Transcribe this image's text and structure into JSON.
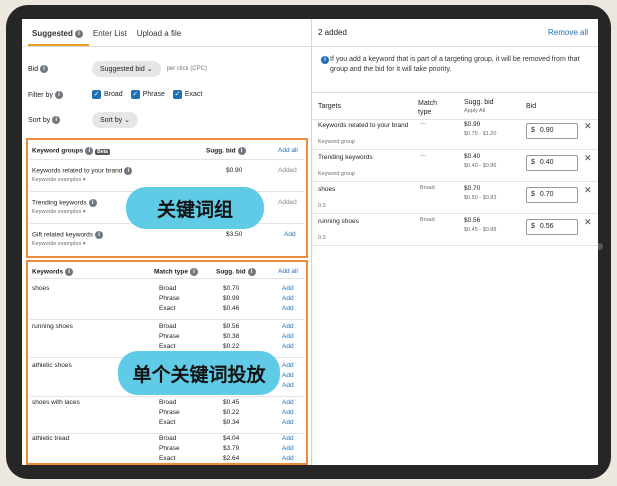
{
  "tabs": [
    "Suggested",
    "Enter List",
    "Upload a file"
  ],
  "bid": {
    "label": "Bid",
    "value": "Suggested bid",
    "note": "per click (CPC)"
  },
  "filter": {
    "label": "Filter by",
    "options": [
      "Broad",
      "Phrase",
      "Exact"
    ]
  },
  "sort": {
    "label": "Sort by",
    "value": "Sort by"
  },
  "groups": {
    "header": "Keyword groups",
    "badge": "Beta",
    "bid_header": "Sugg. bid",
    "add_all": "Add all",
    "items": [
      {
        "name": "Keywords related to your brand",
        "sub": "Keywords examples",
        "bid": "$0.90",
        "action": "Added"
      },
      {
        "name": "Trending keywords",
        "sub": "Keywords examples",
        "bid": "",
        "action": "Added"
      },
      {
        "name": "Gift related keywords",
        "sub": "Keywords examples",
        "bid": "$3.50",
        "action": "Add"
      }
    ]
  },
  "keywords": {
    "header": "Keywords",
    "match_header": "Match type",
    "bid_header": "Sugg. bid",
    "add_all": "Add all",
    "rows": [
      {
        "name": "shoes",
        "items": [
          [
            "Broad",
            "$0.70"
          ],
          [
            "Phrase",
            "$0.99"
          ],
          [
            "Exact",
            "$0.46"
          ]
        ]
      },
      {
        "name": "running shoes",
        "items": [
          [
            "Broad",
            "$0.56"
          ],
          [
            "Phrase",
            "$0.38"
          ],
          [
            "Exact",
            "$0.22"
          ]
        ]
      },
      {
        "name": "athletic shoes",
        "items": [
          [
            "",
            ""
          ],
          [
            "",
            ""
          ],
          [
            "",
            ""
          ]
        ]
      },
      {
        "name": "shoes with laces",
        "items": [
          [
            "Broad",
            "$0.45"
          ],
          [
            "Phrase",
            "$0.22"
          ],
          [
            "Exact",
            "$0.34"
          ]
        ]
      },
      {
        "name": "athletic tread",
        "items": [
          [
            "Broad",
            "$4.04"
          ],
          [
            "Phrase",
            "$3.79"
          ],
          [
            "Exact",
            "$2.64"
          ]
        ]
      }
    ],
    "add": "Add"
  },
  "overlays": {
    "groups_label": "关键词组",
    "single_label": "单个关键词投放"
  },
  "right": {
    "count": "2 added",
    "remove_all": "Remove all",
    "notice": "If you add a keyword that is part of a targeting group, it will be removed from that group and the bid for it will take priority.",
    "headers": {
      "targets": "Targets",
      "match": "Match type",
      "sugg": "Sugg. bid",
      "apply": "Apply All",
      "bid": "Bid"
    },
    "rows": [
      {
        "name": "Keywords related to your brand",
        "sub": "Keyword group",
        "match": "—",
        "sugg": "$0.90",
        "range": "$0.75 - $1.20",
        "bid": "0.90"
      },
      {
        "name": "Trending keywords",
        "sub": "Keyword group",
        "match": "—",
        "sugg": "$0.40",
        "range": "$0.40 - $0.86",
        "bid": "0.40"
      },
      {
        "name": "shoes",
        "sub": "0.0",
        "match": "Broad",
        "sugg": "$0.70",
        "range": "$0.50 - $0.83",
        "bid": "0.70"
      },
      {
        "name": "running shoes",
        "sub": "0.0",
        "match": "Broad",
        "sugg": "$0.56",
        "range": "$0.45 - $0.88",
        "bid": "0.56"
      }
    ],
    "currency": "$"
  },
  "colors": {
    "accent": "#ea8c3c",
    "bubble": "#5fcbe6",
    "link": "#1e6fb8"
  }
}
